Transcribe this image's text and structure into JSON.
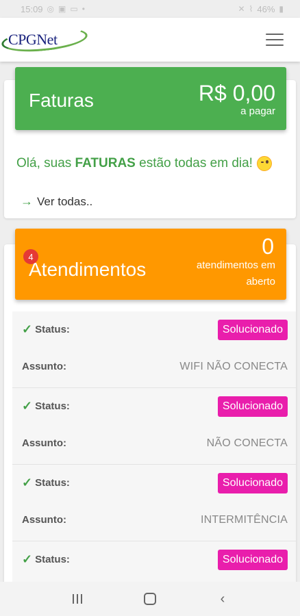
{
  "status_bar": {
    "time": "15:09",
    "battery": "46%"
  },
  "header": {
    "logo_text": "CPGNet"
  },
  "faturas": {
    "title": "Faturas",
    "amount": "R$ 0,00",
    "amount_sub": "a pagar",
    "message_prefix": "Olá, suas ",
    "message_bold": "FATURAS",
    "message_suffix": " estão todas em dia!",
    "ver_todas": "Ver todas.."
  },
  "atendimentos": {
    "title": "Atendimentos",
    "badge": "4",
    "count": "0",
    "count_sub": "atendimentos em aberto",
    "tickets": [
      {
        "status_label": "Status:",
        "status": "Solucionado",
        "assunto_label": "Assunto:",
        "assunto": "WIFI NÃO CONECTA"
      },
      {
        "status_label": "Status:",
        "status": "Solucionado",
        "assunto_label": "Assunto:",
        "assunto": "NÃO CONECTA"
      },
      {
        "status_label": "Status:",
        "status": "Solucionado",
        "assunto_label": "Assunto:",
        "assunto": "INTERMITÊNCIA"
      },
      {
        "status_label": "Status:",
        "status": "Solucionado",
        "assunto_label": "Assunto:",
        "assunto": ""
      }
    ]
  },
  "colors": {
    "faturas_banner": "#4caf50",
    "atendimentos_banner": "#ff9800",
    "status_badge": "#e91eac",
    "notification_badge": "#e53935",
    "message_text": "#43a047"
  },
  "icons": {
    "menu": "hamburger-icon",
    "ver_todas": "arrow-right-icon",
    "ticket_toggle": "chevron-down-icon",
    "emoji": "winking-face-icon"
  }
}
